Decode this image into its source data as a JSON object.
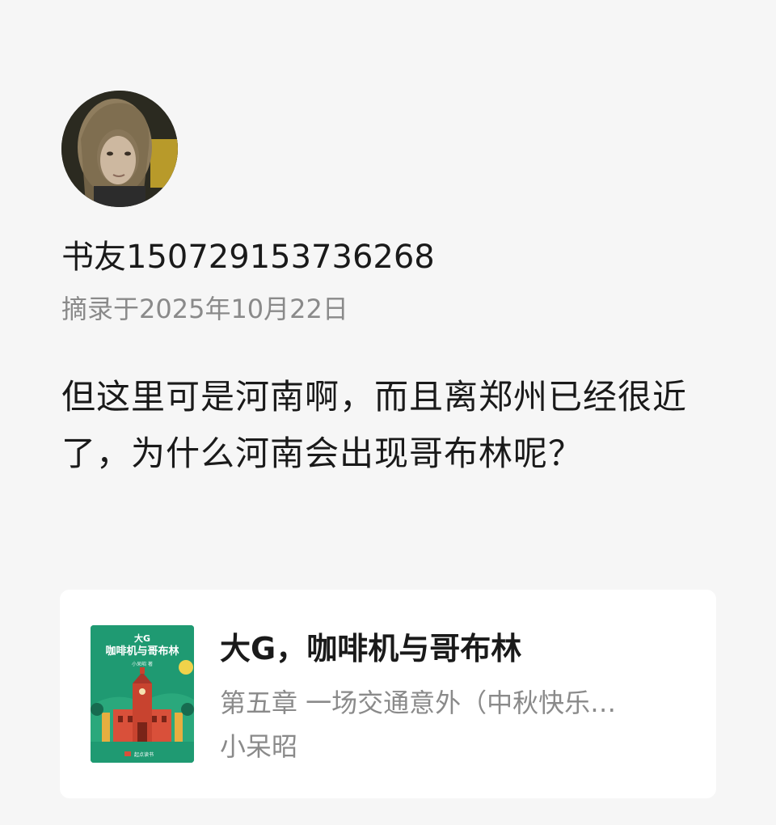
{
  "user": {
    "name": "书友150729153736268",
    "avatar_icon": "user-avatar-photo"
  },
  "excerpt": {
    "date": "摘录于2025年10月22日",
    "text": "但这里可是河南啊，而且离郑州已经很近了，为什么河南会出现哥布林呢？"
  },
  "book": {
    "title": "大G，咖啡机与哥布林",
    "chapter": "第五章 一场交通意外（中秋快乐…",
    "author": "小呆昭",
    "cover": {
      "title_line1": "大G",
      "title_line2": "咖啡机与哥布林",
      "author": "小呆昭 著",
      "publisher": "起点读书",
      "background_color": "#1f9a72",
      "building_color": "#d9503a"
    }
  }
}
